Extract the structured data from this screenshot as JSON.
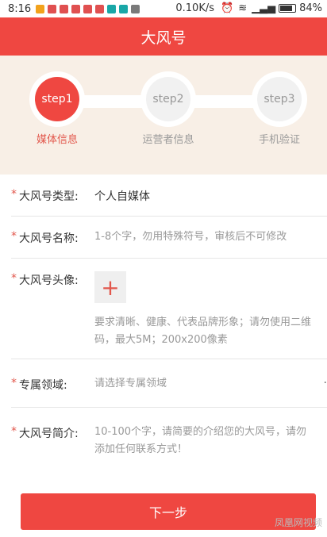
{
  "status_bar": {
    "time": "8:16",
    "speed": "0.10K/s",
    "battery": "84%"
  },
  "header": {
    "title": "大风号"
  },
  "steps": [
    {
      "label": "step1",
      "caption": "媒体信息"
    },
    {
      "label": "step2",
      "caption": "运营者信息"
    },
    {
      "label": "step3",
      "caption": "手机验证"
    }
  ],
  "form": {
    "type": {
      "label": "大风号类型:",
      "value": "个人自媒体"
    },
    "name": {
      "label": "大风号名称:",
      "placeholder": "1-8个字，勿用特殊符号，审核后不可修改"
    },
    "avatar": {
      "label": "大风号头像:",
      "hint": "要求清晰、健康、代表品牌形象；请勿使用二维码，最大5M；200x200像素"
    },
    "field": {
      "label": "专属领域:",
      "placeholder": "请选择专属领域"
    },
    "intro": {
      "label": "大风号简介:",
      "placeholder": "10-100个字，请简要的介绍您的大风号，请勿添加任何联系方式！"
    }
  },
  "next_button": "下一步",
  "watermark": "凤凰网视频",
  "colors": {
    "accent": "#ef4741",
    "banner": "#f8efe6"
  }
}
